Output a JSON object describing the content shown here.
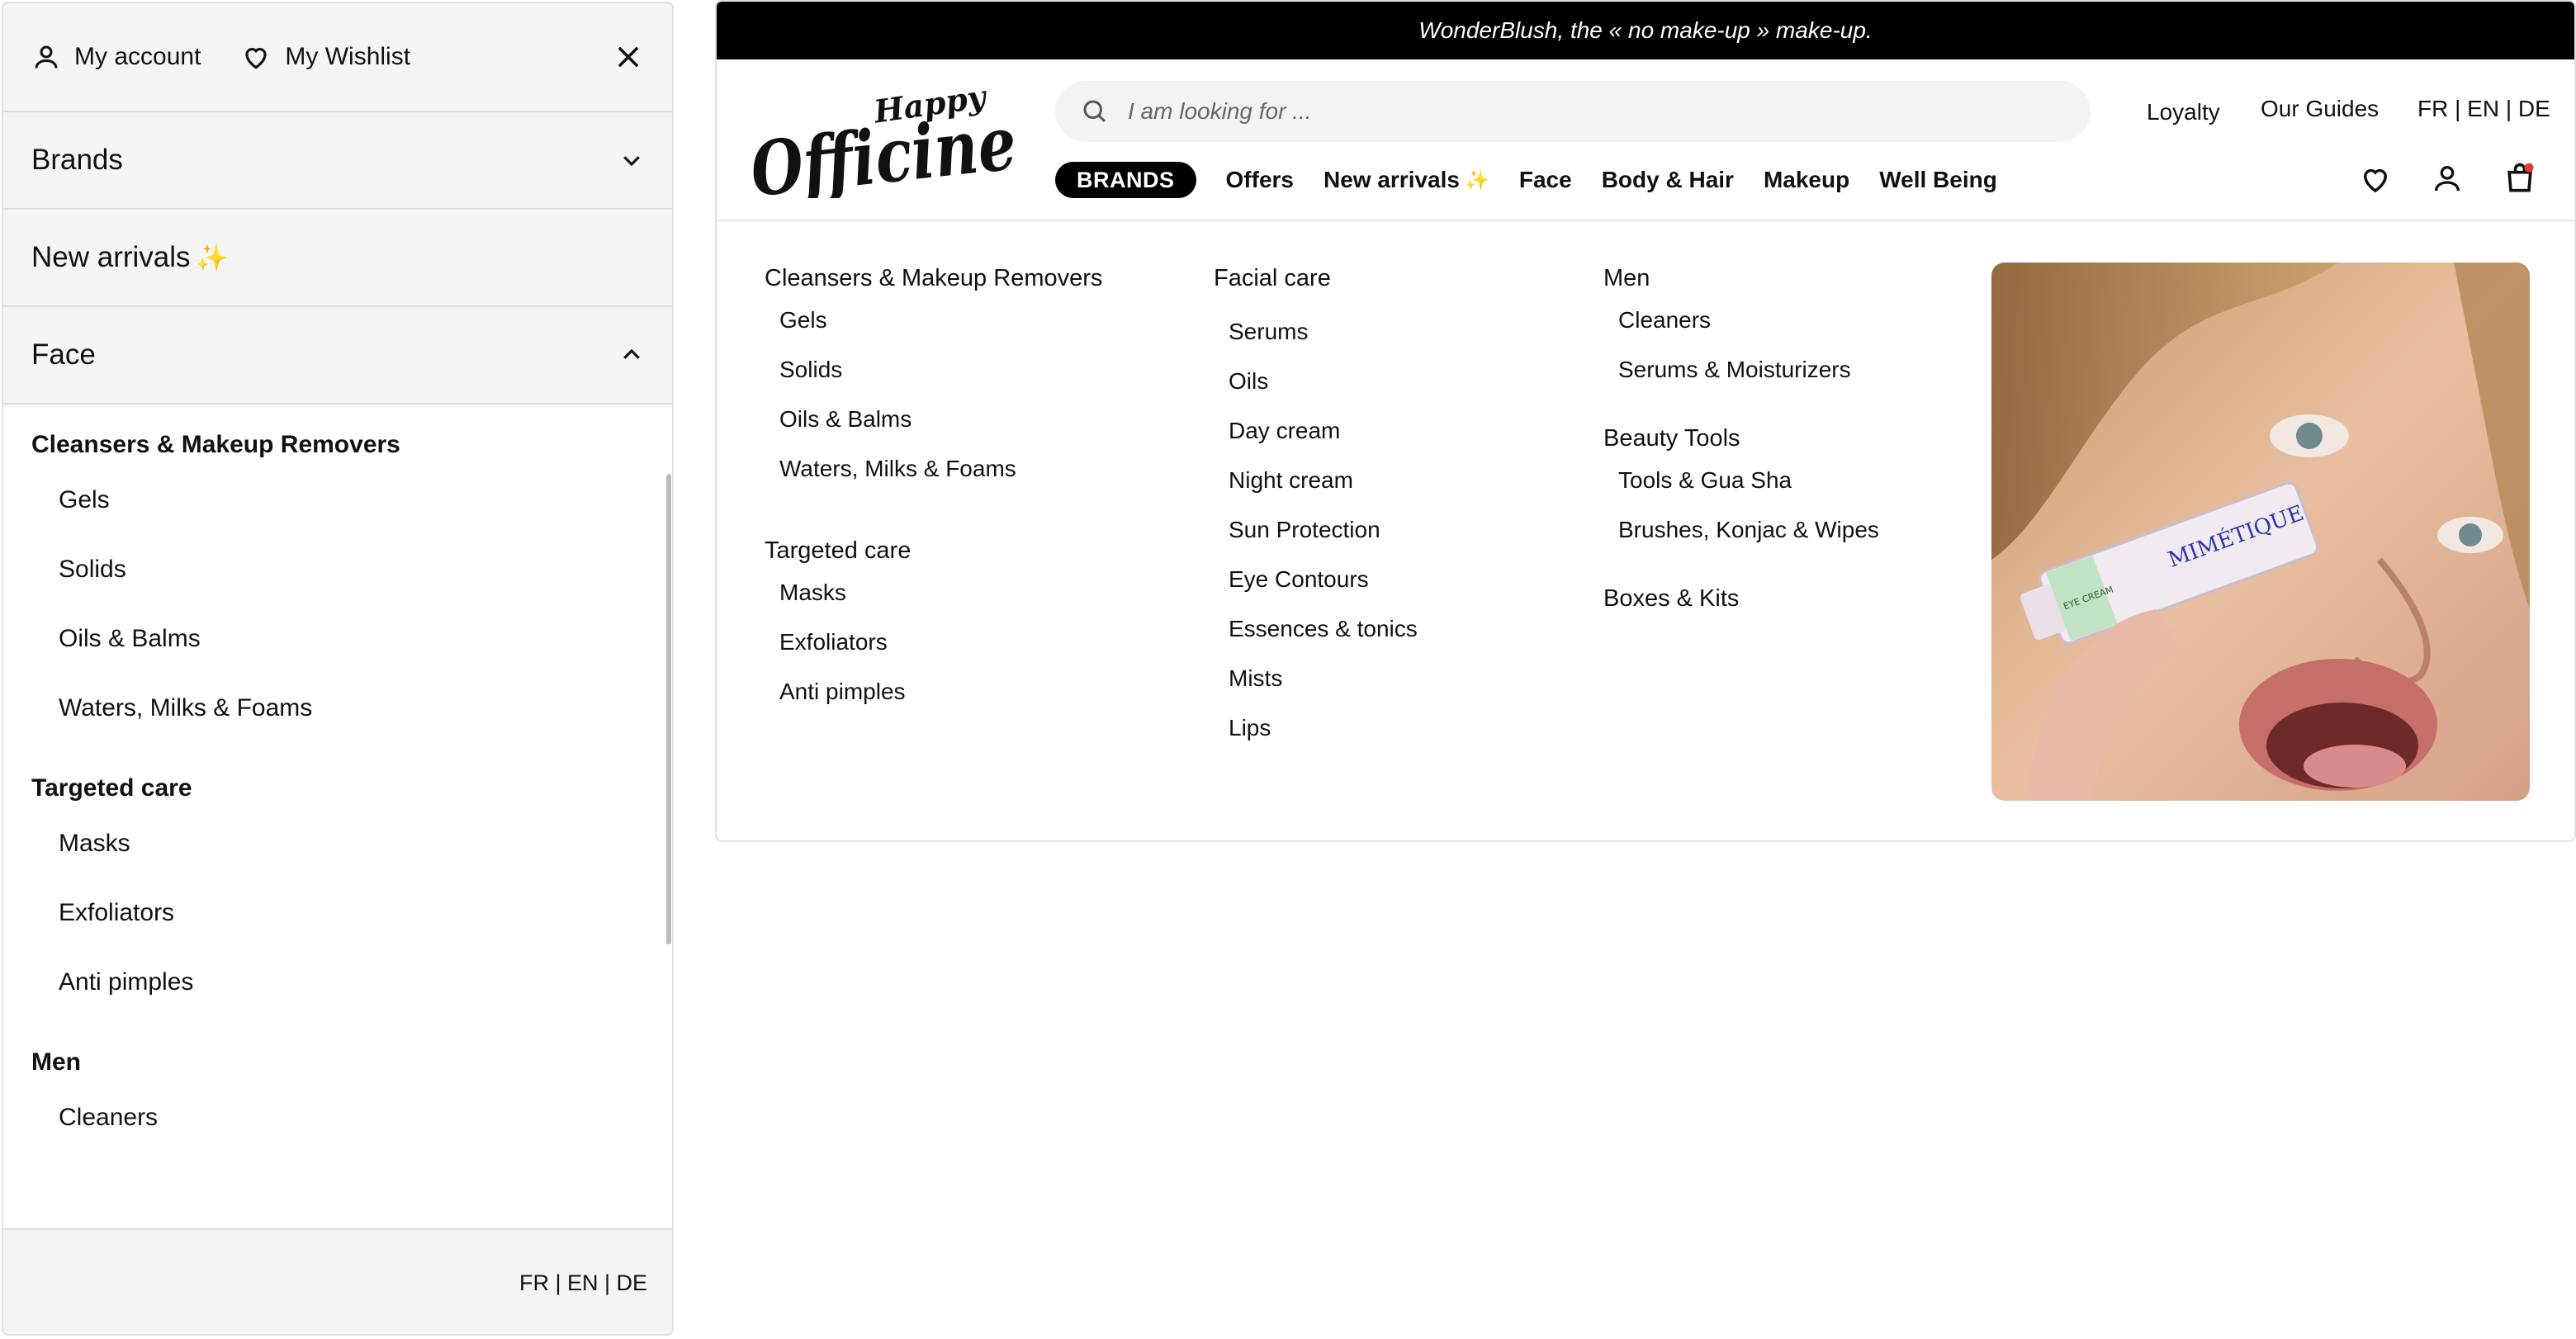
{
  "drawer": {
    "my_account": "My account",
    "my_wishlist": "My Wishlist",
    "rows": [
      {
        "label": "Brands"
      },
      {
        "label": "New arrivals",
        "sparkle": "✨"
      },
      {
        "label": "Face"
      }
    ],
    "groups": [
      {
        "title": "Cleansers & Makeup Removers",
        "items": [
          "Gels",
          "Solids",
          "Oils & Balms",
          "Waters, Milks & Foams"
        ]
      },
      {
        "title": "Targeted care",
        "items": [
          "Masks",
          "Exfoliators",
          "Anti pimples"
        ]
      },
      {
        "title": "Men",
        "items": [
          "Cleaners"
        ]
      }
    ],
    "languages": "FR | EN | DE"
  },
  "promo_bar": {
    "text": "WonderBlush, the « no make-up » make-up."
  },
  "header": {
    "logo_top": "Happy",
    "logo_main": "Officine",
    "search_placeholder": "I am looking for ...",
    "loyalty": "Loyalty",
    "guides": "Our Guides",
    "languages": "FR | EN | DE",
    "cart_badge_color": "#e53935"
  },
  "nav": {
    "brands": "BRANDS",
    "offers": "Offers",
    "new_arrivals": "New arrivals",
    "sparkle": "✨",
    "face": "Face",
    "body_hair": "Body & Hair",
    "makeup": "Makeup",
    "well_being": "Well Being"
  },
  "mega_menu": {
    "col1": {
      "g1_title": "Cleansers & Makeup Removers",
      "g1_items": [
        "Gels",
        "Solids",
        "Oils & Balms",
        "Waters, Milks & Foams"
      ],
      "g2_title": "Targeted care",
      "g2_items": [
        "Masks",
        "Exfoliators",
        "Anti pimples"
      ]
    },
    "col2": {
      "title": "Facial care",
      "items": [
        "Serums",
        "Oils",
        "Day cream",
        "Night cream",
        "Sun Protection",
        "Eye Contours",
        "Essences & tonics",
        "Mists",
        "Lips"
      ]
    },
    "col3": {
      "g1_title": "Men",
      "g1_items": [
        "Cleaners",
        "Serums & Moisturizers"
      ],
      "g2_title": "Beauty Tools",
      "g2_items": [
        "Tools & Gua Sha",
        "Brushes, Konjac & Wipes"
      ],
      "g3_title": "Boxes & Kits"
    },
    "image": {
      "product_brand": "MIMÉTIQUE",
      "product_tag": "EYE CREAM"
    }
  }
}
